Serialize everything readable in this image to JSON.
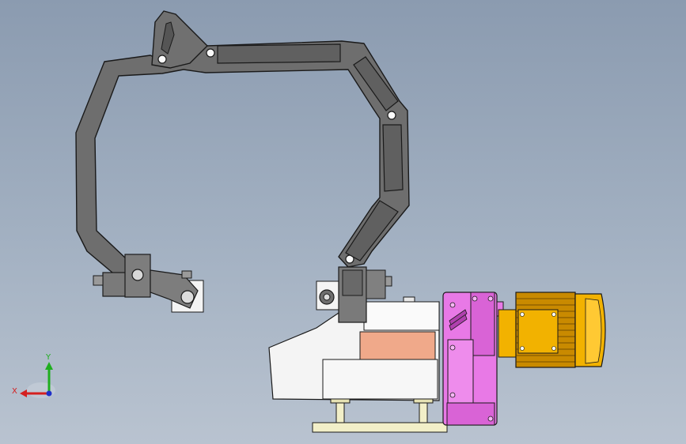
{
  "view": {
    "background_top": "#8b9bb0",
    "background_bottom": "#b9c3d0"
  },
  "triad": {
    "x_label": "X",
    "y_label": "Y",
    "x_color": "#d42020",
    "y_color": "#1fae1f",
    "z_color": "#2030c8"
  },
  "model": {
    "arm_color": "#6e6e6e",
    "gearbox_color": "#e879e6",
    "motor_color": "#f2b200",
    "fins_color": "#c98a00",
    "wear_pad_color": "#f0a98a",
    "base_color": "#f2efc8",
    "housing_color": "#f4f4f4"
  }
}
